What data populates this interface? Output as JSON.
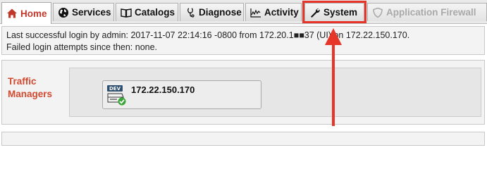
{
  "tabs": [
    {
      "label": "Home",
      "icon": "home-icon",
      "state": "active"
    },
    {
      "label": "Services",
      "icon": "globe-icon",
      "state": "normal"
    },
    {
      "label": "Catalogs",
      "icon": "book-icon",
      "state": "normal"
    },
    {
      "label": "Diagnose",
      "icon": "stethoscope-icon",
      "state": "normal"
    },
    {
      "label": "Activity",
      "icon": "activity-chart-icon",
      "state": "normal"
    },
    {
      "label": "System",
      "icon": "wrench-icon",
      "state": "highlighted"
    },
    {
      "label": "Application Firewall",
      "icon": "shield-icon",
      "state": "disabled"
    }
  ],
  "login": {
    "line1": "Last successful login by admin: 2017-11-07 22:14:16 -0800 from 172.20.1■■37 (UI) on 172.22.150.170.",
    "line2": "Failed login attempts since then: none."
  },
  "traffic_managers": {
    "heading": "Traffic Managers",
    "items": [
      {
        "host": "172.22.150.170",
        "badge": "DEV",
        "status": "ok"
      }
    ]
  },
  "colors": {
    "active_tab_text": "#c0392b",
    "heading_red": "#d24a2f",
    "annotation_red": "#e6362a",
    "status_green": "#3aa53a"
  }
}
